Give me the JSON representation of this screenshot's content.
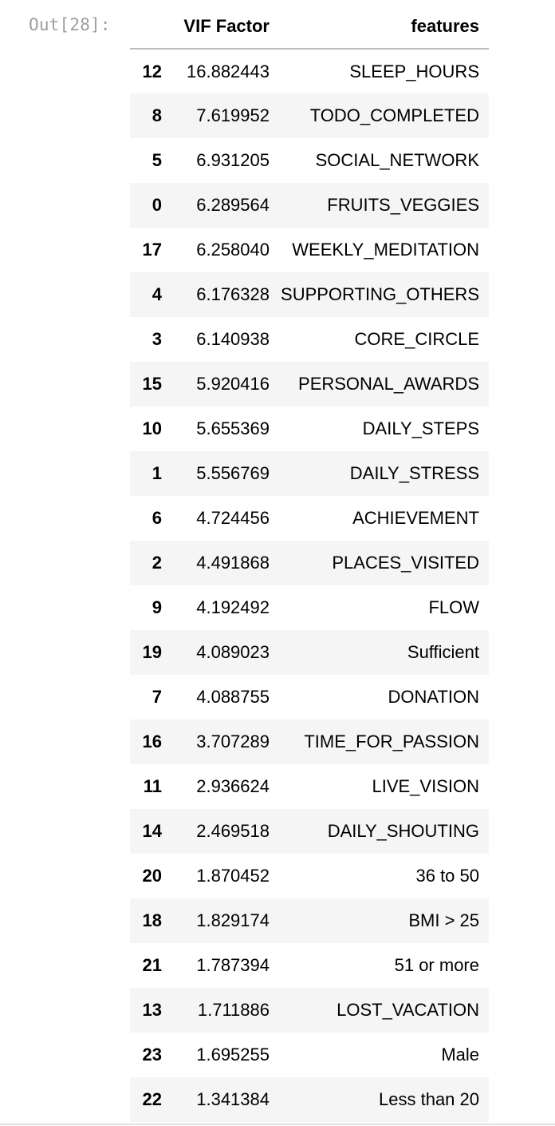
{
  "cell": {
    "prompt": "Out[28]:"
  },
  "table": {
    "columns": {
      "index": "",
      "vif": "VIF Factor",
      "features": "features"
    },
    "rows": [
      {
        "index": "12",
        "vif": "16.882443",
        "feature": "SLEEP_HOURS"
      },
      {
        "index": "8",
        "vif": "7.619952",
        "feature": "TODO_COMPLETED"
      },
      {
        "index": "5",
        "vif": "6.931205",
        "feature": "SOCIAL_NETWORK"
      },
      {
        "index": "0",
        "vif": "6.289564",
        "feature": "FRUITS_VEGGIES"
      },
      {
        "index": "17",
        "vif": "6.258040",
        "feature": "WEEKLY_MEDITATION"
      },
      {
        "index": "4",
        "vif": "6.176328",
        "feature": "SUPPORTING_OTHERS"
      },
      {
        "index": "3",
        "vif": "6.140938",
        "feature": "CORE_CIRCLE"
      },
      {
        "index": "15",
        "vif": "5.920416",
        "feature": "PERSONAL_AWARDS"
      },
      {
        "index": "10",
        "vif": "5.655369",
        "feature": "DAILY_STEPS"
      },
      {
        "index": "1",
        "vif": "5.556769",
        "feature": "DAILY_STRESS"
      },
      {
        "index": "6",
        "vif": "4.724456",
        "feature": "ACHIEVEMENT"
      },
      {
        "index": "2",
        "vif": "4.491868",
        "feature": "PLACES_VISITED"
      },
      {
        "index": "9",
        "vif": "4.192492",
        "feature": "FLOW"
      },
      {
        "index": "19",
        "vif": "4.089023",
        "feature": "Sufficient"
      },
      {
        "index": "7",
        "vif": "4.088755",
        "feature": "DONATION"
      },
      {
        "index": "16",
        "vif": "3.707289",
        "feature": "TIME_FOR_PASSION"
      },
      {
        "index": "11",
        "vif": "2.936624",
        "feature": "LIVE_VISION"
      },
      {
        "index": "14",
        "vif": "2.469518",
        "feature": "DAILY_SHOUTING"
      },
      {
        "index": "20",
        "vif": "1.870452",
        "feature": "36 to 50"
      },
      {
        "index": "18",
        "vif": "1.829174",
        "feature": "BMI > 25"
      },
      {
        "index": "21",
        "vif": "1.787394",
        "feature": "51 or more"
      },
      {
        "index": "13",
        "vif": "1.711886",
        "feature": "LOST_VACATION"
      },
      {
        "index": "23",
        "vif": "1.695255",
        "feature": "Male"
      },
      {
        "index": "22",
        "vif": "1.341384",
        "feature": "Less than 20"
      }
    ]
  },
  "colors": {
    "prompt": "#9e9e9e",
    "stripe": "#f5f5f5",
    "header_rule": "#bdbdbd"
  }
}
